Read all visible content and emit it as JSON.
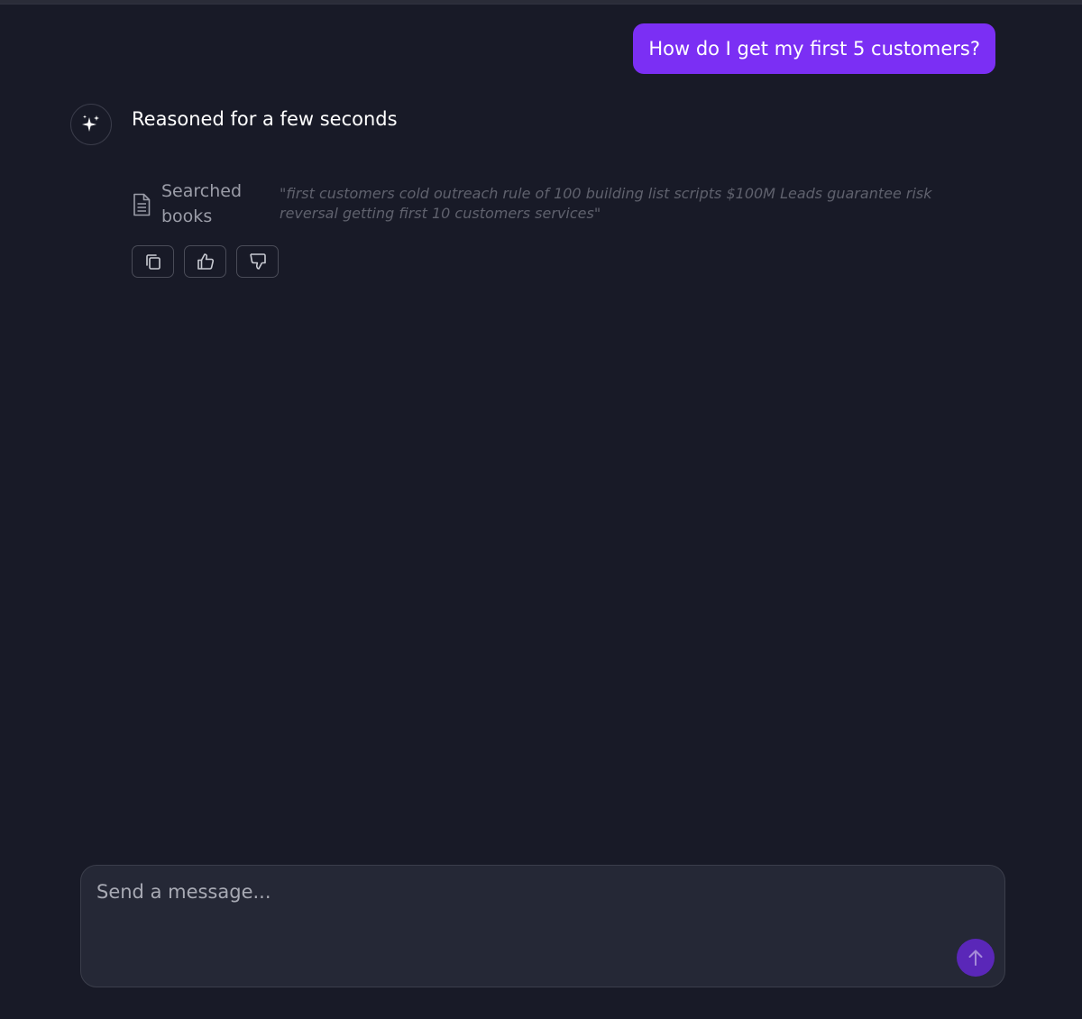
{
  "conversation": {
    "user_message": "How do I get my first 5 customers?",
    "assistant": {
      "reasoning_title": "Reasoned for a few seconds",
      "tool_call": {
        "label": "Searched books",
        "query": "\"first customers cold outreach rule of 100 building list scripts $100M Leads guarantee risk reversal getting first 10 customers services\""
      },
      "actions": [
        "copy-icon",
        "thumbs-up-icon",
        "thumbs-down-icon"
      ]
    }
  },
  "composer": {
    "placeholder": "Send a message...",
    "value": "",
    "send_icon": "arrow-up-icon"
  },
  "colors": {
    "background": "#181a27",
    "user_bubble": "#7b2ff4",
    "send_button": "#5a27b8",
    "composer": "#252836"
  }
}
